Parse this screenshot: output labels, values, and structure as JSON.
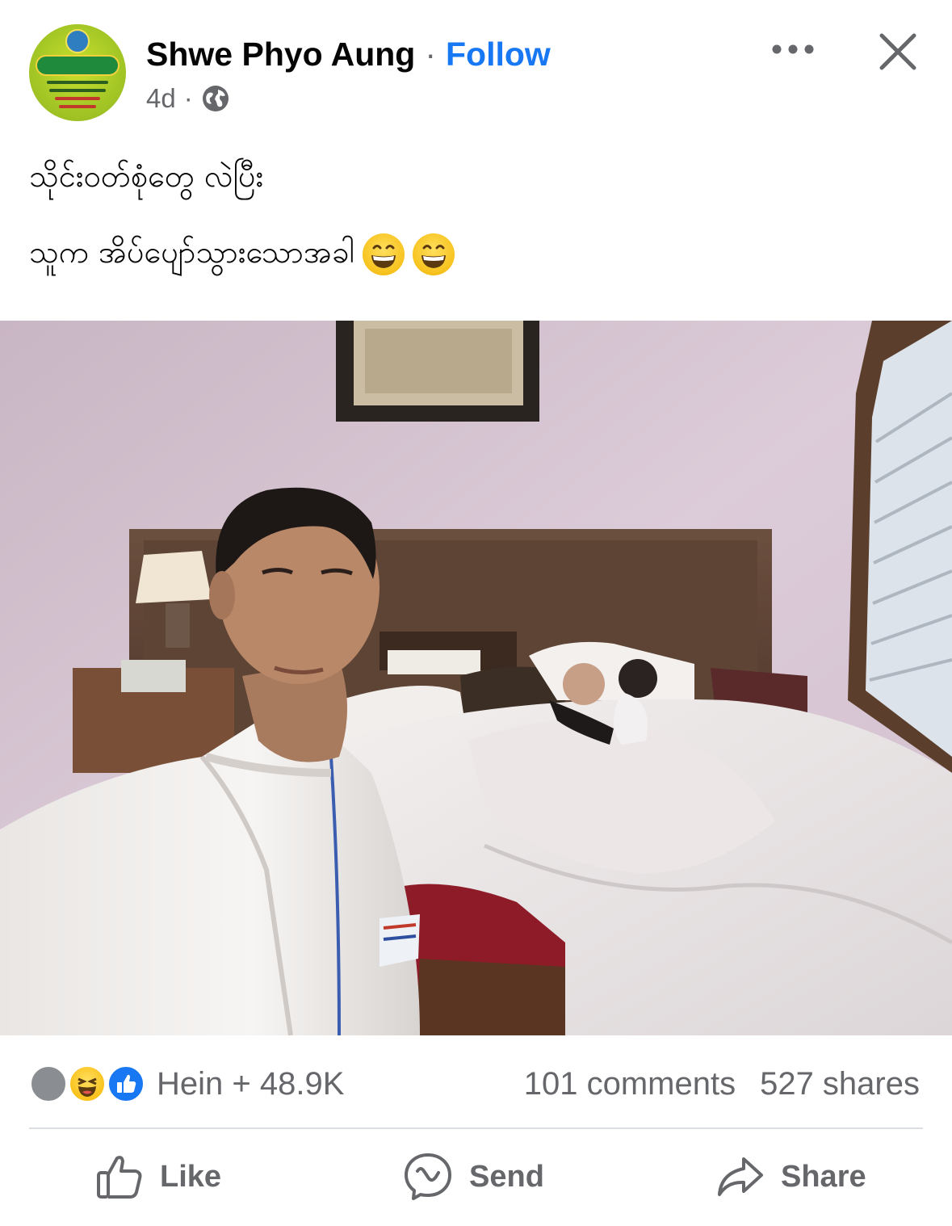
{
  "post": {
    "author": "Shwe Phyo Aung",
    "separator": "·",
    "follow_label": "Follow",
    "time": "4d",
    "meta_separator": "·",
    "audience_icon": "globe-icon",
    "caption_line1": "သိုင်းဝတ်စုံတွေ လဲပြီး",
    "caption_line2": "သူက အိပ်ပျော်သွားသောအခါ",
    "caption_emojis": [
      "grinning-face-emoji",
      "grinning-face-emoji"
    ],
    "photo": "selfie of a man in a white bathrobe in a hotel bedroom, two children sleeping under white covers on the bed"
  },
  "avatar": {
    "colors": {
      "ring": "#a7c926",
      "banner": "#1f8a3b"
    }
  },
  "header_icons": {
    "more": "more-dots-icon",
    "close": "close-icon"
  },
  "reactions": {
    "icons": [
      "reactor-avatar-icon",
      "haha-reaction-icon",
      "like-reaction-icon"
    ],
    "summary": "Hein + 48.9K",
    "comments": "101 comments",
    "shares": "527 shares"
  },
  "actions": {
    "like": "Like",
    "send": "Send",
    "share": "Share"
  },
  "colors": {
    "accent": "#1877f2",
    "secondary_text": "#65676b",
    "divider": "#dadde1"
  }
}
